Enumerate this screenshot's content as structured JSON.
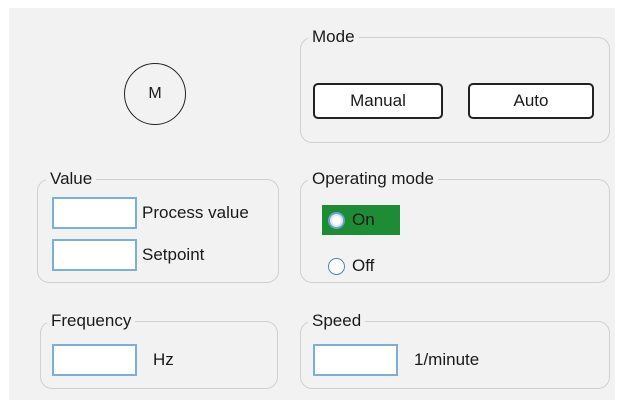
{
  "motor": {
    "label": "M"
  },
  "mode": {
    "title": "Mode",
    "manual_label": "Manual",
    "auto_label": "Auto"
  },
  "value": {
    "title": "Value",
    "process_value_label": "Process value",
    "process_value": "",
    "setpoint_label": "Setpoint",
    "setpoint": ""
  },
  "operating_mode": {
    "title": "Operating mode",
    "options": [
      {
        "label": "On",
        "selected": true
      },
      {
        "label": "Off",
        "selected": false
      }
    ],
    "selected_color": "#1e8c34"
  },
  "frequency": {
    "title": "Frequency",
    "value": "",
    "unit": "Hz"
  },
  "speed": {
    "title": "Speed",
    "value": "",
    "unit": "1/minute"
  },
  "colors": {
    "panel_background": "#f2f2f2",
    "field_border": "#7ab0d8",
    "active_green": "#1e8c34"
  }
}
